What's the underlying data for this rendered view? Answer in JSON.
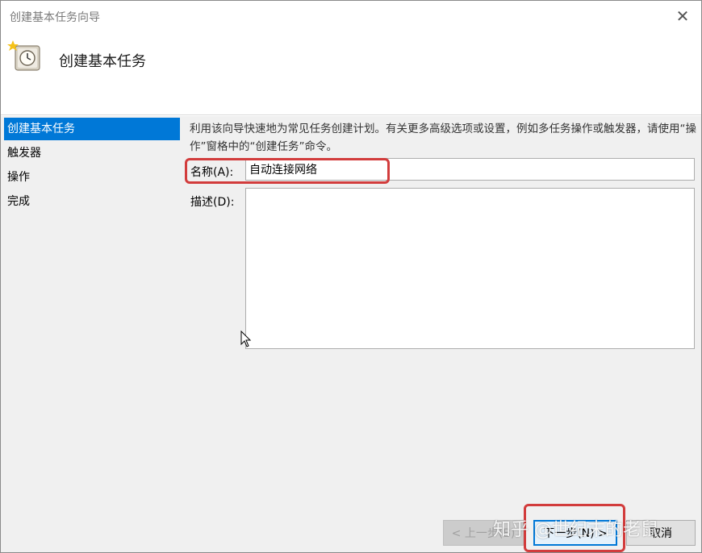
{
  "window": {
    "title": "创建基本任务向导",
    "close_glyph": "✕"
  },
  "header": {
    "title": "创建基本任务",
    "icon": "task-scheduler-clock-icon"
  },
  "sidebar": {
    "items": [
      {
        "label": "创建基本任务",
        "active": true
      },
      {
        "label": "触发器",
        "active": false
      },
      {
        "label": "操作",
        "active": false
      },
      {
        "label": "完成",
        "active": false
      }
    ]
  },
  "content": {
    "description": "利用该向导快速地为常见任务创建计划。有关更多高级选项或设置，例如多任务操作或触发器，请使用“操作”窗格中的“创建任务”命令。",
    "name_label": "名称(A):",
    "name_value": "自动连接网络",
    "desc_label": "描述(D):",
    "desc_value": ""
  },
  "buttons": {
    "back": "< 上一步(B)",
    "next": "下一步(N) >",
    "cancel": "取消"
  },
  "watermark": "知乎 @世纪末的老鼠",
  "colors": {
    "accent": "#0078d7",
    "highlight": "#d23c3c"
  }
}
